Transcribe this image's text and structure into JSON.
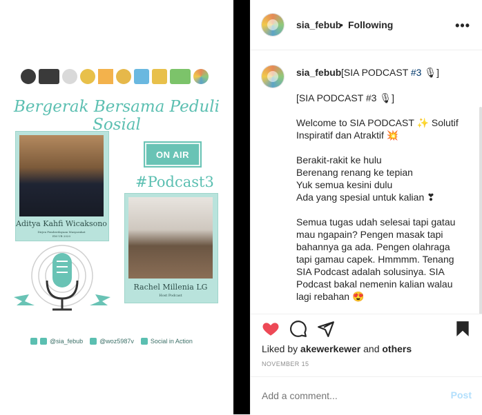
{
  "media": {
    "headline": "Bergerak Bersama Peduli Sosial",
    "on_air": "ON AIR",
    "hashtag": "#Podcast3",
    "guest_name": "Aditya Kahfi Wicaksono",
    "guest_role": "Dirjen Pemberdayaan Masyarakat",
    "guest_org": "EM UB 2020",
    "host_name": "Rachel Millenia LG",
    "host_role": "Host Podcast",
    "social_handle": "@sia_febub",
    "line_id": "@woz5987v",
    "linkedin": "Social in Action"
  },
  "header": {
    "username": "sia_febub",
    "separator": "•",
    "follow_status": "Following",
    "more_icon": "more-horizontal-icon"
  },
  "caption": {
    "username": "sia_febub",
    "first_line": "[SIA PODCAST ",
    "hashtag": "#3",
    "first_line_end": " 🎙]",
    "body": "[SIA PODCAST #3 🎙]\n\nWelcome to SIA PODCAST ✨ Solutif\nInspiratif dan Atraktif 💥\n\nBerakit-rakit ke hulu\nBerenang renang ke tepian\nYuk semua kesini dulu\nAda yang spesial untuk kalian ❣\n\nSemua tugas udah selesai tapi gatau\nmau ngapain? Pengen masak tapi\nbahannya ga ada. Pengen olahraga\ntapi gamau capek. Hmmmm. Tenang\nSIA Podcast adalah solusinya. SIA\nPodcast bakal nemenin kalian walau\nlagi rebahan 😍"
  },
  "actions": {
    "like_icon": "heart-filled-icon",
    "comment_icon": "comment-icon",
    "share_icon": "share-icon",
    "save_icon": "bookmark-filled-icon",
    "heart_color": "#ed4956"
  },
  "likes": {
    "prefix": "Liked by ",
    "user": "akewerkewer",
    "middle": " and ",
    "others": "others"
  },
  "date": "NOVEMBER 15",
  "comment": {
    "placeholder": "Add a comment...",
    "post_label": "Post"
  }
}
